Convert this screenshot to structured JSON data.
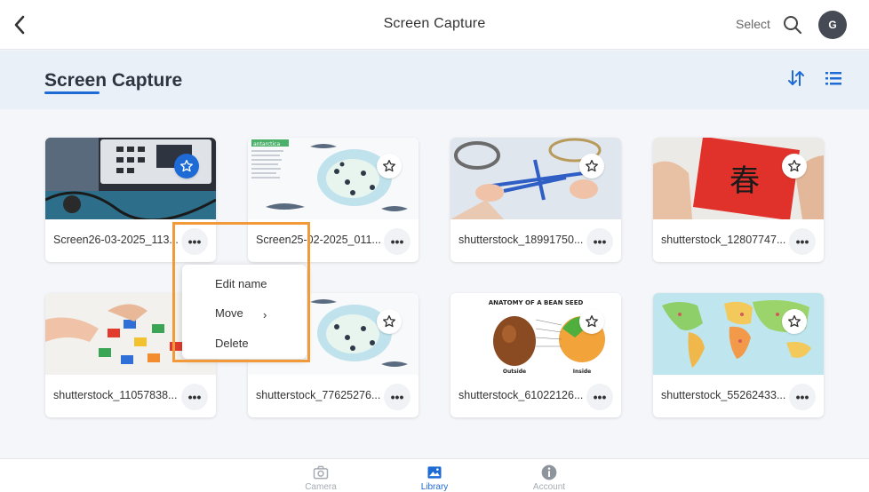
{
  "header": {
    "title": "Screen Capture",
    "select_label": "Select",
    "avatar_initial": "G"
  },
  "section": {
    "title": "Screen Capture"
  },
  "items": [
    {
      "name": "Screen26-03-2025_113...",
      "starred": true
    },
    {
      "name": "Screen25-02-2025_011...",
      "starred": false
    },
    {
      "name": "shutterstock_18991750...",
      "starred": false
    },
    {
      "name": "shutterstock_12807747...",
      "starred": false
    },
    {
      "name": "shutterstock_11057838...",
      "starred": false
    },
    {
      "name": "shutterstock_77625276...",
      "starred": false
    },
    {
      "name": "shutterstock_61022126...",
      "starred": false
    },
    {
      "name": "shutterstock_55262433...",
      "starred": false
    }
  ],
  "thumb_text": {
    "antarctica_heading": "antarctica",
    "bean_title": "ANATOMY OF A BEAN SEED",
    "bean_left": "Outside",
    "bean_right": "Inside",
    "spring_char": "春"
  },
  "context_menu": {
    "edit_name": "Edit name",
    "move": "Move",
    "move_arrow": "›",
    "delete": "Delete"
  },
  "bottom_nav": [
    {
      "label": "Camera",
      "icon": "camera-icon",
      "active": false
    },
    {
      "label": "Library",
      "icon": "image-icon",
      "active": true
    },
    {
      "label": "Account",
      "icon": "info-icon",
      "active": false
    }
  ],
  "colors": {
    "accent": "#1e6bd6",
    "highlight": "#f29a3a"
  }
}
